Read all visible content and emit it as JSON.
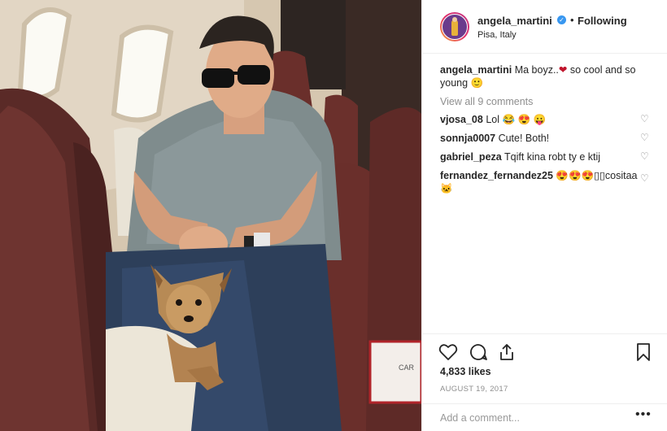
{
  "header": {
    "username": "angela_martini",
    "follow_state": "Following",
    "separator": "•",
    "location": "Pisa, Italy",
    "verified_glyph": "✓"
  },
  "caption": {
    "username": "angela_martini",
    "text_start": "Ma boyz..",
    "heart": "❤",
    "text_end": " so cool and so young ",
    "emoji": "🙂"
  },
  "view_all": "View all 9 comments",
  "comments": [
    {
      "username": "vjosa_08",
      "text": "Lol 😂 😍 😛"
    },
    {
      "username": "sonnja0007",
      "text": "Cute! Both!"
    },
    {
      "username": "gabriel_peza",
      "text": "Tqift kina robt ty e ktij"
    },
    {
      "username": "fernandez_fernandez25",
      "text": "😍😍😍▯▯cositaa 🐱"
    }
  ],
  "likes": "4,833 likes",
  "date": "AUGUST 19, 2017",
  "add_comment_placeholder": "Add a comment...",
  "more_label": "•••",
  "icons": {
    "like": "heart-outline-icon",
    "comment": "speech-bubble-icon",
    "share": "share-upload-icon",
    "save": "bookmark-icon",
    "comment_like": "small-heart-icon"
  },
  "colors": {
    "link_blue": "#3897f0",
    "muted": "#8e8e8e",
    "text": "#262626"
  }
}
